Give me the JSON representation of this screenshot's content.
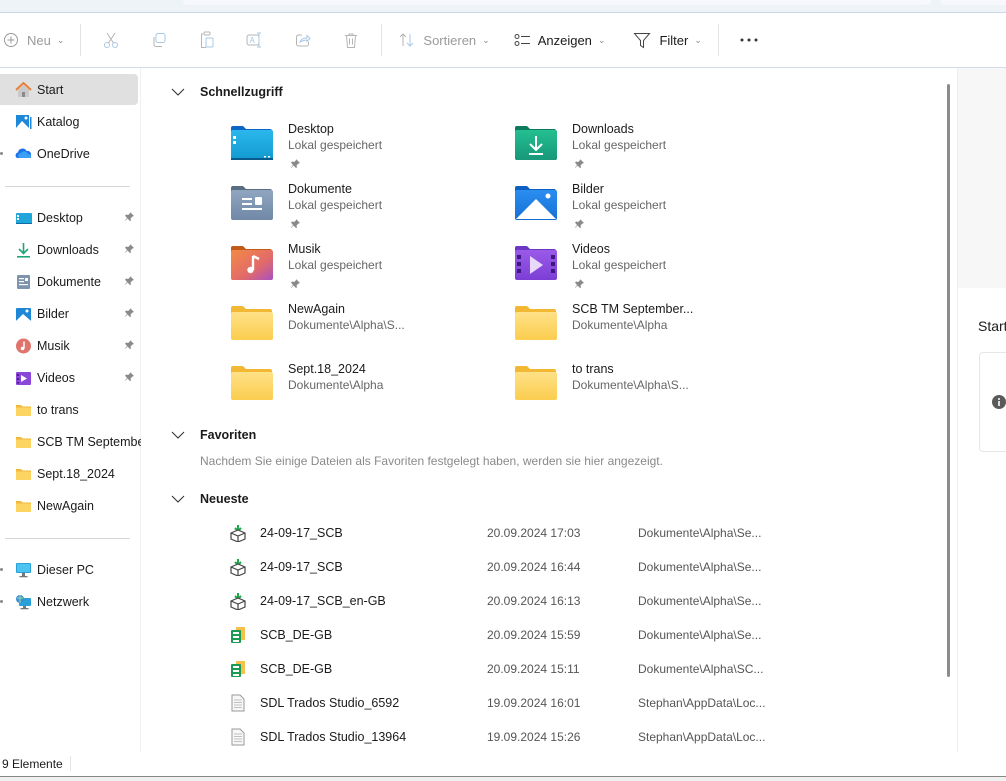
{
  "toolbar": {
    "new_label": "Neu",
    "sort_label": "Sortieren",
    "view_label": "Anzeigen",
    "filter_label": "Filter",
    "more_label": "..."
  },
  "sidebar": {
    "items": [
      {
        "label": "Start",
        "icon": "home-icon",
        "selected": true
      },
      {
        "label": "Katalog",
        "icon": "gallery-icon"
      },
      {
        "label": "OneDrive",
        "icon": "onedrive-cloud-icon"
      },
      {
        "label": "Desktop",
        "icon": "desktop-folder-icon",
        "pinned": true
      },
      {
        "label": "Downloads",
        "icon": "download-icon",
        "pinned": true
      },
      {
        "label": "Dokumente",
        "icon": "documents-icon",
        "pinned": true
      },
      {
        "label": "Bilder",
        "icon": "pictures-icon",
        "pinned": true
      },
      {
        "label": "Musik",
        "icon": "music-icon",
        "pinned": true
      },
      {
        "label": "Videos",
        "icon": "videos-icon",
        "pinned": true
      },
      {
        "label": "to trans",
        "icon": "folder-icon"
      },
      {
        "label": "SCB TM September",
        "icon": "folder-icon"
      },
      {
        "label": "Sept.18_2024",
        "icon": "folder-icon"
      },
      {
        "label": "NewAgain",
        "icon": "folder-icon"
      },
      {
        "label": "Dieser PC",
        "icon": "this-pc-icon"
      },
      {
        "label": "Netzwerk",
        "icon": "network-icon"
      }
    ]
  },
  "main": {
    "quick_access": {
      "title": "Schnellzugriff",
      "items": [
        {
          "name": "Desktop",
          "sub": "Lokal gespeichert",
          "pinned": true,
          "icon": "desktop-folder-icon"
        },
        {
          "name": "Downloads",
          "sub": "Lokal gespeichert",
          "pinned": true,
          "icon": "downloads-folder-icon"
        },
        {
          "name": "Dokumente",
          "sub": "Lokal gespeichert",
          "pinned": true,
          "icon": "documents-folder-icon"
        },
        {
          "name": "Bilder",
          "sub": "Lokal gespeichert",
          "pinned": true,
          "icon": "pictures-folder-icon"
        },
        {
          "name": "Musik",
          "sub": "Lokal gespeichert",
          "pinned": true,
          "icon": "music-folder-icon"
        },
        {
          "name": "Videos",
          "sub": "Lokal gespeichert",
          "pinned": true,
          "icon": "videos-folder-icon"
        },
        {
          "name": "NewAgain",
          "sub": "Dokumente\\Alpha\\S...",
          "icon": "folder-icon"
        },
        {
          "name": "SCB TM September...",
          "sub": "Dokumente\\Alpha",
          "icon": "folder-icon"
        },
        {
          "name": "Sept.18_2024",
          "sub": "Dokumente\\Alpha",
          "icon": "folder-icon"
        },
        {
          "name": "to trans",
          "sub": "Dokumente\\Alpha\\S...",
          "icon": "folder-icon"
        }
      ]
    },
    "favorites": {
      "title": "Favoriten",
      "empty_message": "Nachdem Sie einige Dateien als Favoriten festgelegt haben, werden sie hier angezeigt."
    },
    "recent": {
      "title": "Neueste",
      "rows": [
        {
          "name": "24-09-17_SCB",
          "date": "20.09.2024 17:03",
          "path": "Dokumente\\Alpha\\Se...",
          "icon": "package-icon"
        },
        {
          "name": "24-09-17_SCB",
          "date": "20.09.2024 16:44",
          "path": "Dokumente\\Alpha\\Se...",
          "icon": "package-icon"
        },
        {
          "name": "24-09-17_SCB_en-GB",
          "date": "20.09.2024 16:13",
          "path": "Dokumente\\Alpha\\Se...",
          "icon": "package-icon"
        },
        {
          "name": "SCB_DE-GB",
          "date": "20.09.2024 15:59",
          "path": "Dokumente\\Alpha\\Se...",
          "icon": "project-file-icon"
        },
        {
          "name": "SCB_DE-GB",
          "date": "20.09.2024 15:11",
          "path": "Dokumente\\Alpha\\SC...",
          "icon": "project-file-icon"
        },
        {
          "name": "SDL Trados Studio_6592",
          "date": "19.09.2024 16:01",
          "path": "Stephan\\AppData\\Loc...",
          "icon": "text-file-icon"
        },
        {
          "name": "SDL Trados Studio_13964",
          "date": "19.09.2024 15:26",
          "path": "Stephan\\AppData\\Loc...",
          "icon": "text-file-icon"
        }
      ]
    }
  },
  "details": {
    "title": "Start"
  },
  "statusbar": {
    "item_count": "9 Elemente"
  }
}
